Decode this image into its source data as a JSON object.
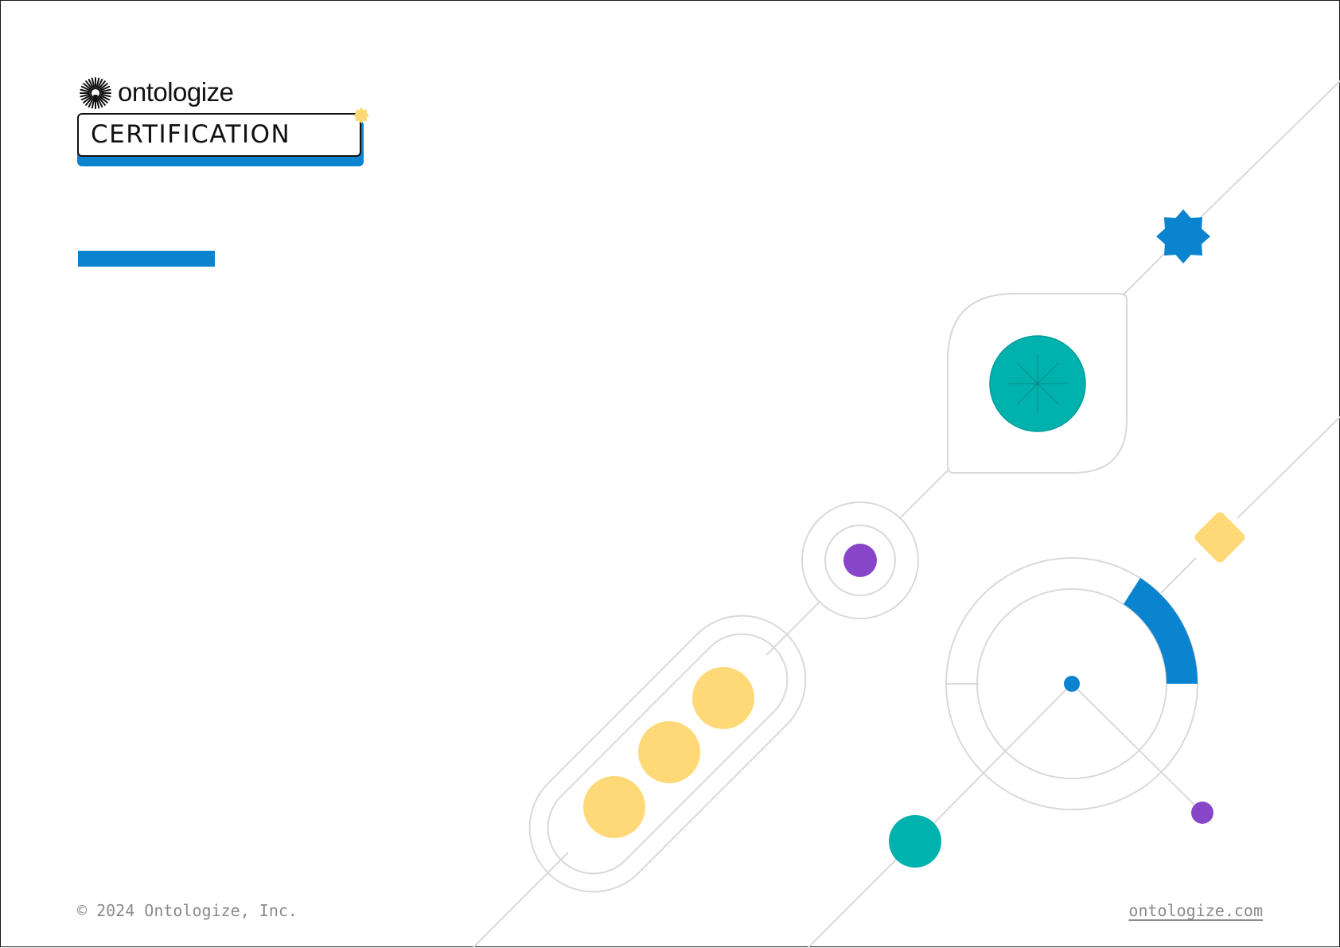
{
  "brand": {
    "name": "ontologize",
    "badge_label": "CERTIFICATION",
    "logo_icon": "sunburst-logo-icon"
  },
  "colors": {
    "blue": "#0a84cf",
    "teal": "#00b2ad",
    "yellow": "#ffd977",
    "purple": "#8746c8",
    "line_gray": "#d9d9d9"
  },
  "footer": {
    "copyright": "© 2024 Ontologize, Inc.",
    "website": "ontologize.com"
  }
}
